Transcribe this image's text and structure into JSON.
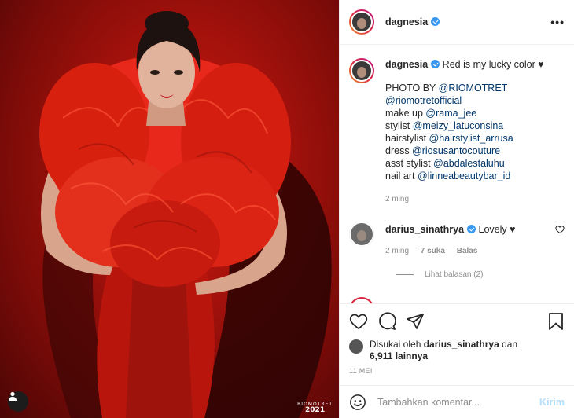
{
  "photo": {
    "watermark_brand": "RIOMOTRET",
    "watermark_year": "2021"
  },
  "header": {
    "username": "dagnesia"
  },
  "caption": {
    "username": "dagnesia",
    "text": "Red is my lucky color ♥",
    "lines": [
      {
        "prefix": "PHOTO BY ",
        "mention": "@RIOMOTRET"
      },
      {
        "prefix": "",
        "mention": "@riomotretofficial"
      },
      {
        "prefix": "make up ",
        "mention": "@rama_jee"
      },
      {
        "prefix": "stylist ",
        "mention": "@meizy_latuconsina"
      },
      {
        "prefix": "hairstylist ",
        "mention": "@hairstylist_arrusa"
      },
      {
        "prefix": "dress ",
        "mention": "@riosusantocouture"
      },
      {
        "prefix": "asst stylist ",
        "mention": "@abdalestaluhu"
      },
      {
        "prefix": "nail art ",
        "mention": "@linneabeautybar_id"
      }
    ],
    "time": "2 ming"
  },
  "comment": {
    "username": "darius_sinathrya",
    "text": "Lovely ♥",
    "time": "2 ming",
    "likes": "7 suka",
    "reply": "Balas",
    "view_replies": "Lihat balasan (2)"
  },
  "likes": {
    "prefix": "Disukai oleh ",
    "user": "darius_sinathrya",
    "middle": " dan",
    "count": "6,911 lainnya"
  },
  "date": "11 MEI",
  "add_comment": {
    "placeholder": "Tambahkan komentar...",
    "post_label": "Kirim"
  },
  "colors": {
    "verified": "#3897f0",
    "link": "#00376b",
    "post_button": "#b2dffc",
    "photo_red": "#c5190f"
  }
}
